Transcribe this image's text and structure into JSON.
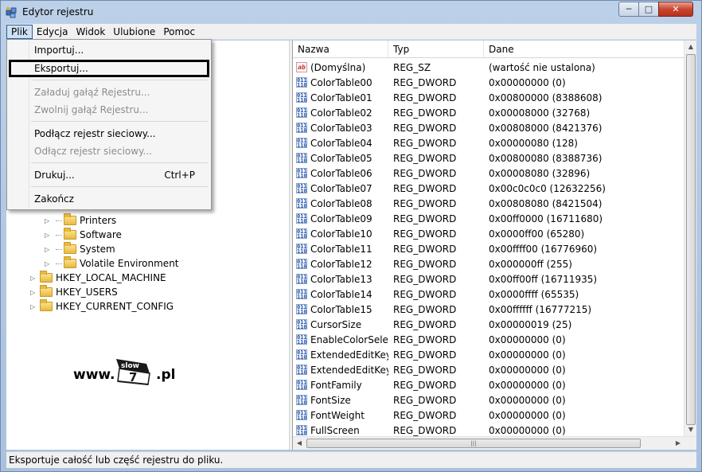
{
  "window": {
    "title": "Edytor rejestru"
  },
  "menubar": [
    {
      "label": "Plik"
    },
    {
      "label": "Edycja"
    },
    {
      "label": "Widok"
    },
    {
      "label": "Ulubione"
    },
    {
      "label": "Pomoc"
    }
  ],
  "file_menu": {
    "import": "Importuj...",
    "export": "Eksportuj...",
    "load_hive": "Załaduj gałąź Rejestru...",
    "unload_hive": "Zwolnij gałąź Rejestru...",
    "connect_network": "Podłącz rejestr sieciowy...",
    "disconnect_network": "Odłącz rejestr sieciowy...",
    "print": "Drukuj...",
    "print_shortcut": "Ctrl+P",
    "exit": "Zakończ"
  },
  "tree": {
    "items": [
      {
        "label": "Printers"
      },
      {
        "label": "Software"
      },
      {
        "label": "System"
      },
      {
        "label": "Volatile Environment"
      },
      {
        "label": "HKEY_LOCAL_MACHINE"
      },
      {
        "label": "HKEY_USERS"
      },
      {
        "label": "HKEY_CURRENT_CONFIG"
      }
    ]
  },
  "logo": {
    "www": "www.",
    "flag_text": "slow",
    "seven": "7",
    "pl": ".pl"
  },
  "list": {
    "columns": {
      "name": "Nazwa",
      "type": "Typ",
      "data": "Dane"
    },
    "rows": [
      {
        "name": "(Domyślna)",
        "type": "REG_SZ",
        "data": "(wartość nie ustalona)",
        "icon": "string-value-icon"
      },
      {
        "name": "ColorTable00",
        "type": "REG_DWORD",
        "data": "0x00000000 (0)",
        "icon": "dword-value-icon"
      },
      {
        "name": "ColorTable01",
        "type": "REG_DWORD",
        "data": "0x00800000 (8388608)",
        "icon": "dword-value-icon"
      },
      {
        "name": "ColorTable02",
        "type": "REG_DWORD",
        "data": "0x00008000 (32768)",
        "icon": "dword-value-icon"
      },
      {
        "name": "ColorTable03",
        "type": "REG_DWORD",
        "data": "0x00808000 (8421376)",
        "icon": "dword-value-icon"
      },
      {
        "name": "ColorTable04",
        "type": "REG_DWORD",
        "data": "0x00000080 (128)",
        "icon": "dword-value-icon"
      },
      {
        "name": "ColorTable05",
        "type": "REG_DWORD",
        "data": "0x00800080 (8388736)",
        "icon": "dword-value-icon"
      },
      {
        "name": "ColorTable06",
        "type": "REG_DWORD",
        "data": "0x00008080 (32896)",
        "icon": "dword-value-icon"
      },
      {
        "name": "ColorTable07",
        "type": "REG_DWORD",
        "data": "0x00c0c0c0 (12632256)",
        "icon": "dword-value-icon"
      },
      {
        "name": "ColorTable08",
        "type": "REG_DWORD",
        "data": "0x00808080 (8421504)",
        "icon": "dword-value-icon"
      },
      {
        "name": "ColorTable09",
        "type": "REG_DWORD",
        "data": "0x00ff0000 (16711680)",
        "icon": "dword-value-icon"
      },
      {
        "name": "ColorTable10",
        "type": "REG_DWORD",
        "data": "0x0000ff00 (65280)",
        "icon": "dword-value-icon"
      },
      {
        "name": "ColorTable11",
        "type": "REG_DWORD",
        "data": "0x00ffff00 (16776960)",
        "icon": "dword-value-icon"
      },
      {
        "name": "ColorTable12",
        "type": "REG_DWORD",
        "data": "0x000000ff (255)",
        "icon": "dword-value-icon"
      },
      {
        "name": "ColorTable13",
        "type": "REG_DWORD",
        "data": "0x00ff00ff (16711935)",
        "icon": "dword-value-icon"
      },
      {
        "name": "ColorTable14",
        "type": "REG_DWORD",
        "data": "0x0000ffff (65535)",
        "icon": "dword-value-icon"
      },
      {
        "name": "ColorTable15",
        "type": "REG_DWORD",
        "data": "0x00ffffff (16777215)",
        "icon": "dword-value-icon"
      },
      {
        "name": "CursorSize",
        "type": "REG_DWORD",
        "data": "0x00000019 (25)",
        "icon": "dword-value-icon"
      },
      {
        "name": "EnableColorSele...",
        "type": "REG_DWORD",
        "data": "0x00000000 (0)",
        "icon": "dword-value-icon"
      },
      {
        "name": "ExtendedEditKey",
        "type": "REG_DWORD",
        "data": "0x00000000 (0)",
        "icon": "dword-value-icon"
      },
      {
        "name": "ExtendedEditKey...",
        "type": "REG_DWORD",
        "data": "0x00000000 (0)",
        "icon": "dword-value-icon"
      },
      {
        "name": "FontFamily",
        "type": "REG_DWORD",
        "data": "0x00000000 (0)",
        "icon": "dword-value-icon"
      },
      {
        "name": "FontSize",
        "type": "REG_DWORD",
        "data": "0x00000000 (0)",
        "icon": "dword-value-icon"
      },
      {
        "name": "FontWeight",
        "type": "REG_DWORD",
        "data": "0x00000000 (0)",
        "icon": "dword-value-icon"
      },
      {
        "name": "FullScreen",
        "type": "REG_DWORD",
        "data": "0x00000000 (0)",
        "icon": "dword-value-icon"
      }
    ]
  },
  "statusbar": {
    "text": "Eksportuje całość lub część rejestru do pliku."
  },
  "colors": {
    "menu_highlight": "#cfe0f4",
    "folder": "#e7b941",
    "close_button": "#c8452f"
  }
}
